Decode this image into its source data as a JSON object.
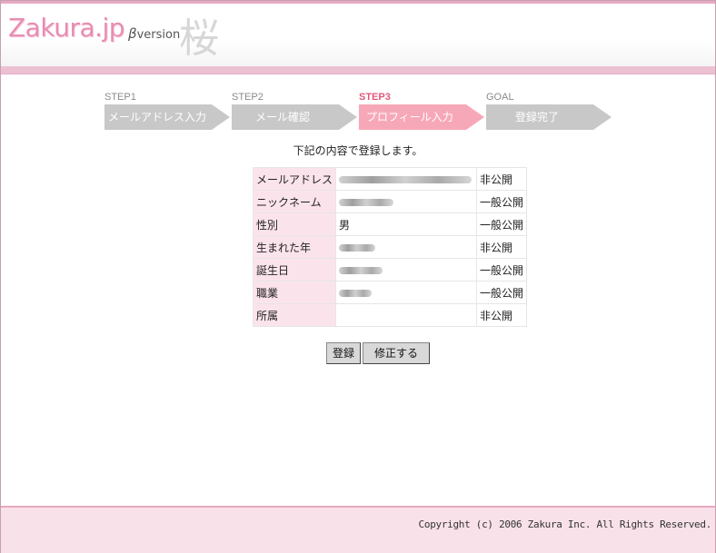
{
  "header": {
    "logo": "Zakura.jp",
    "beta_greek": "β",
    "beta_text": "version",
    "deco_kanji": "桜"
  },
  "steps": [
    {
      "label": "STEP1",
      "title": "メールアドレス入力",
      "active": false
    },
    {
      "label": "STEP2",
      "title": "メール確認",
      "active": false
    },
    {
      "label": "STEP3",
      "title": "プロフィール入力",
      "active": true
    },
    {
      "label": "GOAL",
      "title": "登録完了",
      "active": false
    }
  ],
  "intro": "下記の内容で登録します。",
  "profile_rows": [
    {
      "key": "メールアドレス",
      "value": "",
      "privacy": "非公開"
    },
    {
      "key": "ニックネーム",
      "value": "",
      "privacy": "一般公開"
    },
    {
      "key": "性別",
      "value": "男",
      "privacy": "一般公開"
    },
    {
      "key": "生まれた年",
      "value": "",
      "privacy": "非公開"
    },
    {
      "key": "誕生日",
      "value": "",
      "privacy": "一般公開"
    },
    {
      "key": "職業",
      "value": "",
      "privacy": "一般公開"
    },
    {
      "key": "所属",
      "value": "",
      "privacy": "非公開"
    }
  ],
  "buttons": {
    "register": "登録",
    "edit": "修正する"
  },
  "footer": {
    "copyright": "Copyright (c) 2006 Zakura Inc. All Rights Reserved."
  },
  "colors": {
    "accent_pink": "#e88cb2",
    "active_step": "#f7a8b8",
    "inactive_step": "#c8c8c8",
    "key_cell_bg": "#fbe3ec",
    "footer_bg": "#f9e1ea"
  }
}
